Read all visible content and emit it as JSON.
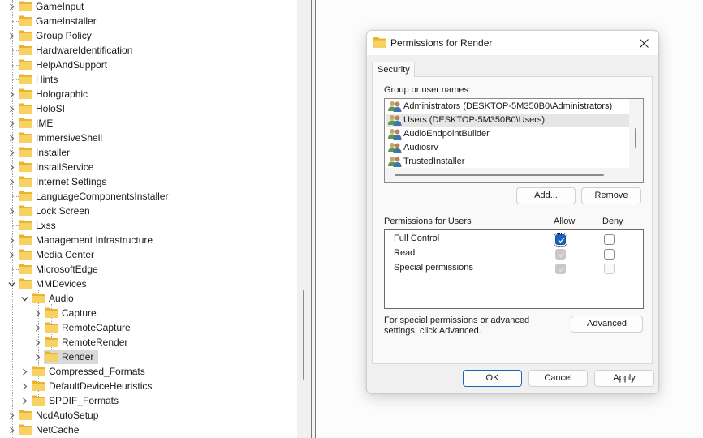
{
  "tree": {
    "items": [
      {
        "label": "GameInput",
        "expander": "collapsed",
        "level": 0
      },
      {
        "label": "GameInstaller",
        "expander": "none",
        "level": 0
      },
      {
        "label": "Group Policy",
        "expander": "collapsed",
        "level": 0
      },
      {
        "label": "HardwareIdentification",
        "expander": "none",
        "level": 0
      },
      {
        "label": "HelpAndSupport",
        "expander": "none",
        "level": 0
      },
      {
        "label": "Hints",
        "expander": "none",
        "level": 0
      },
      {
        "label": "Holographic",
        "expander": "collapsed",
        "level": 0
      },
      {
        "label": "HoloSI",
        "expander": "collapsed",
        "level": 0
      },
      {
        "label": "IME",
        "expander": "collapsed",
        "level": 0
      },
      {
        "label": "ImmersiveShell",
        "expander": "collapsed",
        "level": 0
      },
      {
        "label": "Installer",
        "expander": "collapsed",
        "level": 0
      },
      {
        "label": "InstallService",
        "expander": "collapsed",
        "level": 0
      },
      {
        "label": "Internet Settings",
        "expander": "collapsed",
        "level": 0
      },
      {
        "label": "LanguageComponentsInstaller",
        "expander": "none",
        "level": 0
      },
      {
        "label": "Lock Screen",
        "expander": "collapsed",
        "level": 0
      },
      {
        "label": "Lxss",
        "expander": "none",
        "level": 0
      },
      {
        "label": "Management Infrastructure",
        "expander": "collapsed",
        "level": 0
      },
      {
        "label": "Media Center",
        "expander": "collapsed",
        "level": 0
      },
      {
        "label": "MicrosoftEdge",
        "expander": "none",
        "level": 0
      },
      {
        "label": "MMDevices",
        "expander": "expanded",
        "level": 0
      },
      {
        "label": "Audio",
        "expander": "expanded",
        "level": 1
      },
      {
        "label": "Capture",
        "expander": "collapsed",
        "level": 2
      },
      {
        "label": "RemoteCapture",
        "expander": "collapsed",
        "level": 2
      },
      {
        "label": "RemoteRender",
        "expander": "collapsed",
        "level": 2
      },
      {
        "label": "Render",
        "expander": "collapsed",
        "level": 2,
        "selected": true
      },
      {
        "label": "Compressed_Formats",
        "expander": "collapsed",
        "level": 1
      },
      {
        "label": "DefaultDeviceHeuristics",
        "expander": "collapsed",
        "level": 1
      },
      {
        "label": "SPDIF_Formats",
        "expander": "collapsed",
        "level": 1
      },
      {
        "label": "NcdAutoSetup",
        "expander": "collapsed",
        "level": 0
      },
      {
        "label": "NetCache",
        "expander": "collapsed",
        "level": 0
      }
    ]
  },
  "dialog": {
    "title": "Permissions for Render",
    "close_icon": "close-icon",
    "tab": "Security",
    "group_label": "Group or user names:",
    "users": [
      {
        "name": "Administrators (DESKTOP-5M350B0\\Administrators)",
        "selected": false
      },
      {
        "name": "Users (DESKTOP-5M350B0\\Users)",
        "selected": true
      },
      {
        "name": "AudioEndpointBuilder",
        "selected": false
      },
      {
        "name": "Audiosrv",
        "selected": false
      },
      {
        "name": "TrustedInstaller",
        "selected": false
      }
    ],
    "add_label": "Add...",
    "remove_label": "Remove",
    "permissions_label": "Permissions for Users",
    "allow_label": "Allow",
    "deny_label": "Deny",
    "permissions": [
      {
        "name": "Full Control",
        "allow": "checked",
        "deny": "unchecked"
      },
      {
        "name": "Read",
        "allow": "checked-disabled",
        "deny": "unchecked"
      },
      {
        "name": "Special permissions",
        "allow": "checked-disabled",
        "deny": "unchecked-disabled"
      }
    ],
    "advanced_text": "For special permissions or advanced settings, click Advanced.",
    "advanced_label": "Advanced",
    "ok_label": "OK",
    "cancel_label": "Cancel",
    "apply_label": "Apply"
  },
  "colors": {
    "accent": "#1a64c0",
    "folder": "#f5c542",
    "selection": "#d9d9d9"
  }
}
